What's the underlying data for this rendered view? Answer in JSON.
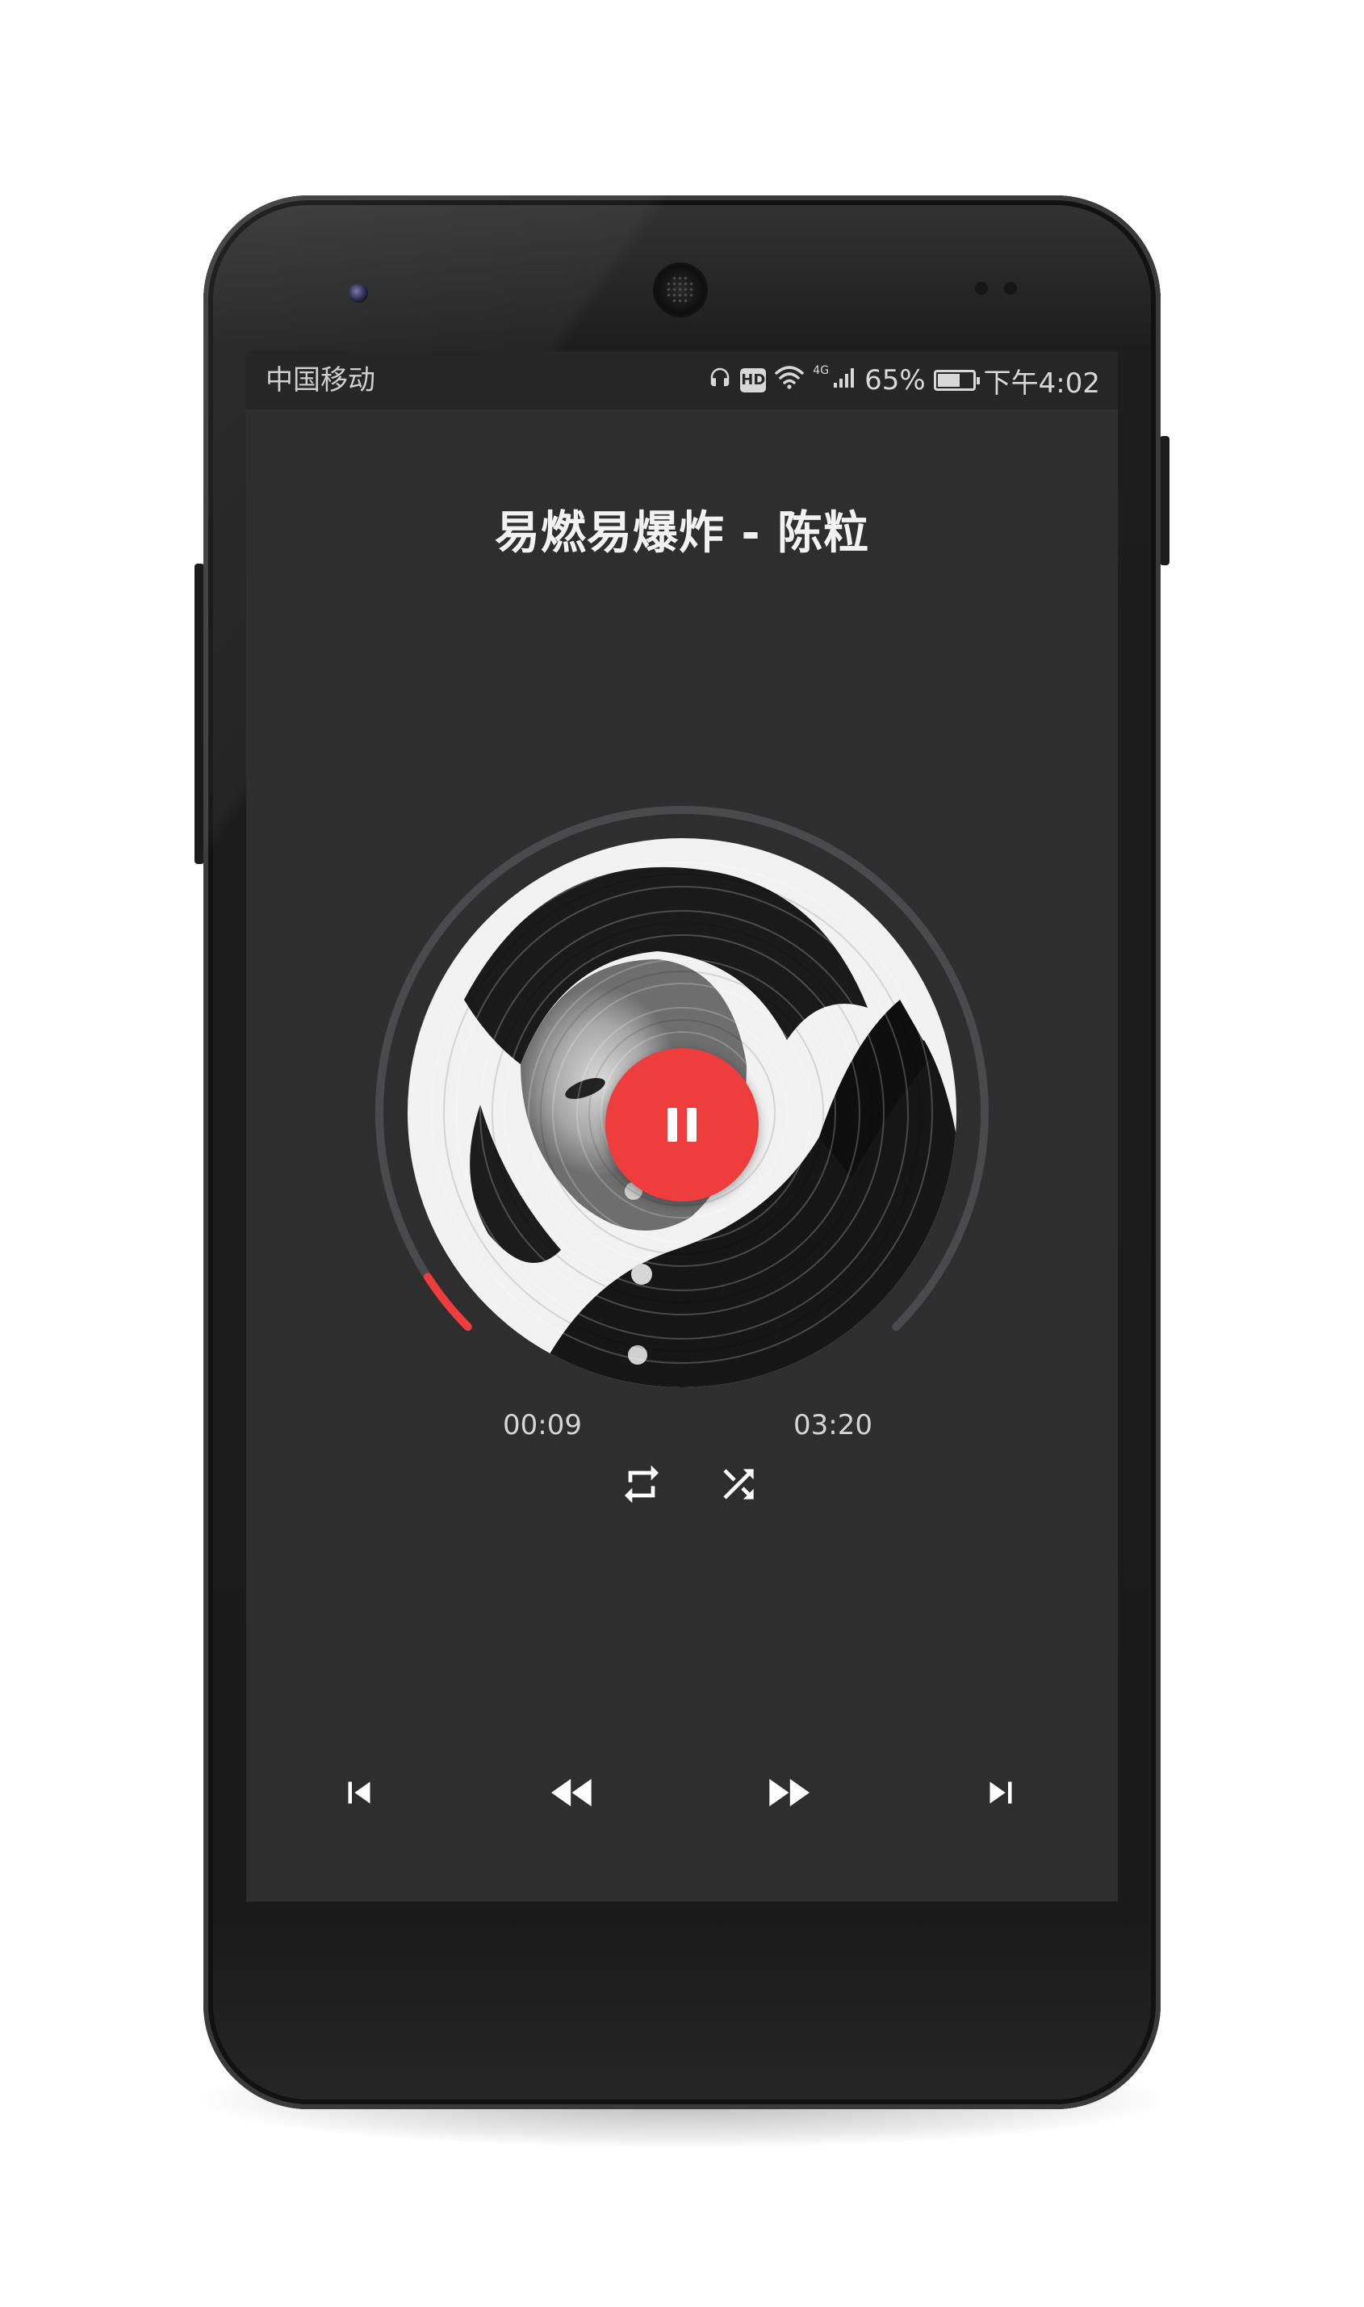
{
  "status_bar": {
    "carrier": "中国移动",
    "network_badge": "HD",
    "signal_type": "4G",
    "battery_percent": "65%",
    "battery_level": 0.65,
    "time": "下午4:02",
    "icons": [
      "headphones-icon",
      "hd-icon",
      "wifi-icon",
      "signal-icon",
      "battery-icon"
    ]
  },
  "player": {
    "song_title": "易燃易爆炸 - 陈粒",
    "elapsed": "00:09",
    "duration": "03:20",
    "progress": 0.045,
    "state": "playing",
    "accent_color": "#ef3d3d",
    "background_color": "#2e2e2f",
    "track_color": "#4a4a4c"
  },
  "controls": {
    "play_pause_icon": "pause-icon",
    "repeat_icon": "repeat-icon",
    "shuffle_icon": "shuffle-icon",
    "prev_icon": "skip-previous-icon",
    "rewind_icon": "rewind-icon",
    "forward_icon": "fast-forward-icon",
    "next_icon": "skip-next-icon"
  }
}
